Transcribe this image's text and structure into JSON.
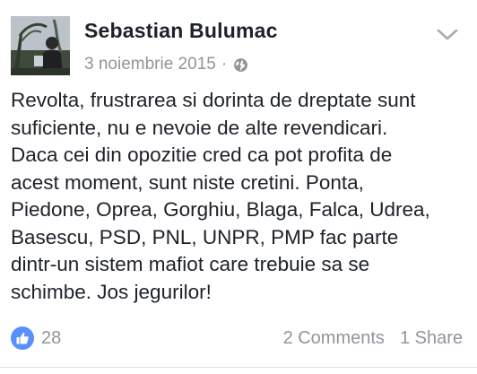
{
  "post": {
    "author": "Sebastian Bulumac",
    "date": "3 noiembrie 2015",
    "separator": "·",
    "audience_icon": "globe-icon",
    "menu_icon": "chevron-down-icon",
    "text": "Revolta, frustrarea si dorinta de dreptate sunt\nsuficiente, nu e nevoie de alte revendicari.\nDaca cei din opozitie cred ca pot profita de\nacest moment, sunt niste cretini. Ponta,\nPiedone, Oprea, Gorghiu, Blaga, Falca, Udrea,\nBasescu, PSD, PNL, UNPR, PMP fac parte\ndintr-un sistem mafiot care trebuie sa se\nschimbe. Jos jegurilor!"
  },
  "reactions": {
    "icon": "like-thumb-icon",
    "count": "28",
    "comments": "2 Comments",
    "shares": "1 Share"
  },
  "colors": {
    "text": "#1d2129",
    "meta": "#90949c",
    "like_badge": "#5890ff",
    "divider": "#dddfe2"
  }
}
